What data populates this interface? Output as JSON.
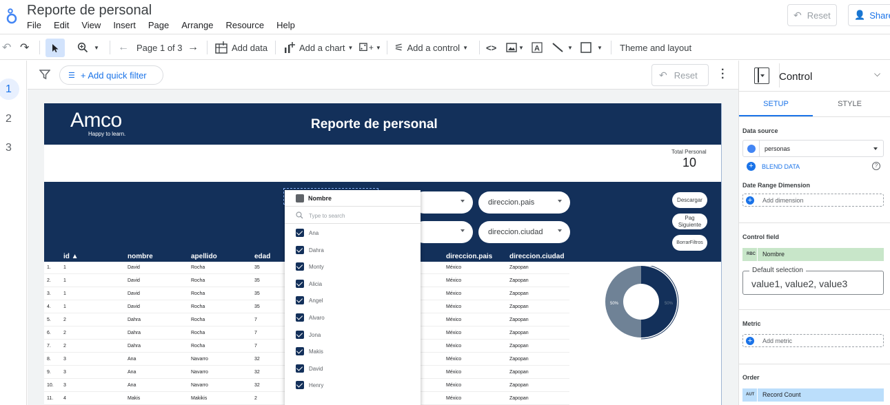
{
  "header": {
    "title": "Reporte de personal",
    "menu": [
      "File",
      "Edit",
      "View",
      "Insert",
      "Page",
      "Arrange",
      "Resource",
      "Help"
    ],
    "reset_label": "Reset",
    "share_label": "Share"
  },
  "toolbar": {
    "page_label": "Page 1 of 3",
    "add_data": "Add data",
    "add_chart": "Add a chart",
    "add_control": "Add a control",
    "theme_layout": "Theme and layout"
  },
  "pages": [
    "1",
    "2",
    "3"
  ],
  "filterbar": {
    "add_quick_filter": "+ Add quick filter",
    "reset_label": "Reset"
  },
  "report": {
    "logo_text": "Amco",
    "logo_tagline": "Happy to learn.",
    "title": "Reporte de personal",
    "scorecard": {
      "label": "Total Personal",
      "value": "10"
    },
    "filters": {
      "pais": "direccion.pais",
      "ciudad": "direccion.ciudad"
    },
    "buttons": {
      "descargar": "Descargar",
      "siguiente": "Pag Siguiente",
      "borrar": "BorrarFiltros"
    },
    "table": {
      "columns": [
        "id ▲",
        "nombre",
        "apellido",
        "edad",
        "direccion.pais",
        "direccion.ciudad"
      ],
      "rows": [
        [
          "1.",
          "1",
          "David",
          "Rocha",
          "35",
          "México",
          "Zapopan"
        ],
        [
          "2.",
          "1",
          "David",
          "Rocha",
          "35",
          "México",
          "Zapopan"
        ],
        [
          "3.",
          "1",
          "David",
          "Rocha",
          "35",
          "México",
          "Zapopan"
        ],
        [
          "4.",
          "1",
          "David",
          "Rocha",
          "35",
          "México",
          "Zapopan"
        ],
        [
          "5.",
          "2",
          "Dahra",
          "Rocha",
          "7",
          "México",
          "Zapopan"
        ],
        [
          "6.",
          "2",
          "Dahra",
          "Rocha",
          "7",
          "México",
          "Zapopan"
        ],
        [
          "7.",
          "2",
          "Dahra",
          "Rocha",
          "7",
          "México",
          "Zapopan"
        ],
        [
          "8.",
          "3",
          "Ana",
          "Navarro",
          "32",
          "México",
          "Zapopan"
        ],
        [
          "9.",
          "3",
          "Ana",
          "Navarro",
          "32",
          "México",
          "Zapopan"
        ],
        [
          "10.",
          "3",
          "Ana",
          "Navarro",
          "32",
          "México",
          "Zapopan"
        ],
        [
          "11.",
          "4",
          "Makis",
          "Makikis",
          "2",
          "México",
          "Zapopan"
        ]
      ]
    },
    "donut": {
      "left_label": "50%",
      "right_label": "50%",
      "slices": [
        50,
        50
      ],
      "colors": [
        "#13305a",
        "#6f8296"
      ]
    }
  },
  "dropdown": {
    "header": "Nombre",
    "search_placeholder": "Type to search",
    "items": [
      "Ana",
      "Dahra",
      "Monty",
      "Alicia",
      "Angel",
      "Alvaro",
      "Jona",
      "Makis",
      "David",
      "Henry"
    ]
  },
  "panel": {
    "title": "Control",
    "tab_setup": "SETUP",
    "tab_style": "STYLE",
    "data_source_label": "Data source",
    "data_source_value": "personas",
    "blend_data": "BLEND DATA",
    "date_range_label": "Date Range Dimension",
    "add_dimension": "Add dimension",
    "control_field_label": "Control field",
    "control_field_type": "RBC",
    "control_field_value": "Nombre",
    "default_selection_label": "Default selection",
    "default_selection_value": "value1, value2, value3",
    "metric_label": "Metric",
    "add_metric": "Add metric",
    "order_label": "Order",
    "order_type": "AUT",
    "order_value": "Record Count"
  },
  "colors": {
    "accent": "#1a73e8",
    "navy": "#13305a",
    "green_chip": "#c8e6c9",
    "blue_chip": "#bbdefb"
  }
}
